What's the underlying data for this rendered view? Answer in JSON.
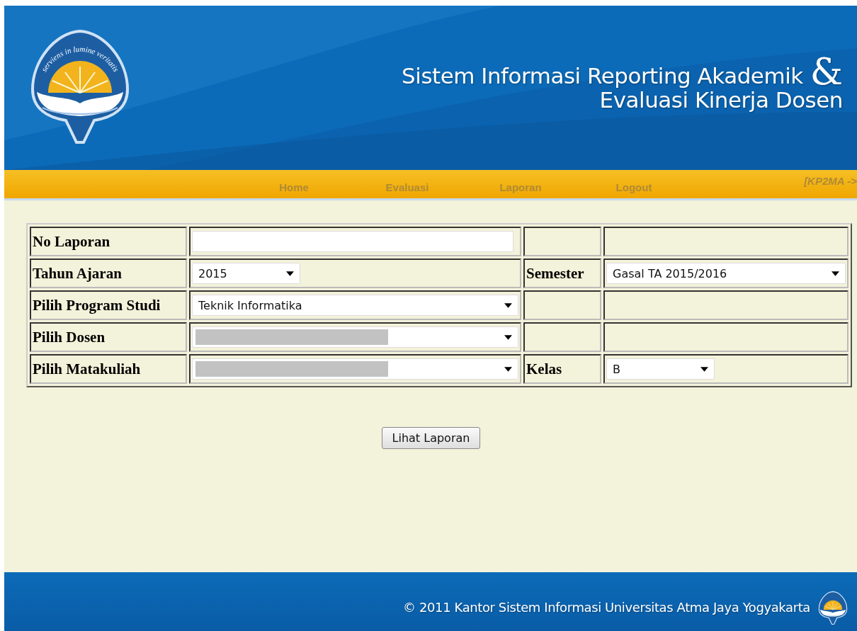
{
  "header": {
    "logo_motto": "serviens in lumine veritatis",
    "title_line1": "Sistem Informasi Reporting Akademik",
    "ampersand": "&",
    "title_line2": "Evaluasi Kinerja Dosen"
  },
  "nav": {
    "items": [
      {
        "label": "Home"
      },
      {
        "label": "Evaluasi"
      },
      {
        "label": "Laporan"
      },
      {
        "label": "Logout"
      }
    ],
    "user": "[KP2MA ->"
  },
  "form": {
    "rows": [
      {
        "label": "No Laporan",
        "field": {
          "kind": "text"
        }
      },
      {
        "label": "Tahun Ajaran",
        "field": {
          "kind": "short-select",
          "value": "2015"
        },
        "side_label": "Semester",
        "side_field": {
          "kind": "select",
          "value": "Gasal TA 2015/2016"
        }
      },
      {
        "label": "Pilih Program Studi",
        "field": {
          "kind": "select",
          "value": "Teknik Informatika"
        }
      },
      {
        "label": "Pilih Dosen",
        "field": {
          "kind": "select",
          "redacted": true
        }
      },
      {
        "label": "Pilih Matakuliah",
        "field": {
          "kind": "select",
          "redacted": true
        },
        "side_label": "Kelas",
        "side_field": {
          "kind": "short-select",
          "value": "B"
        }
      }
    ]
  },
  "submit": {
    "label": "Lihat Laporan"
  },
  "footer": {
    "text": "© 2011 Kantor Sistem Informasi Universitas Atma Jaya Yogyakarta"
  }
}
